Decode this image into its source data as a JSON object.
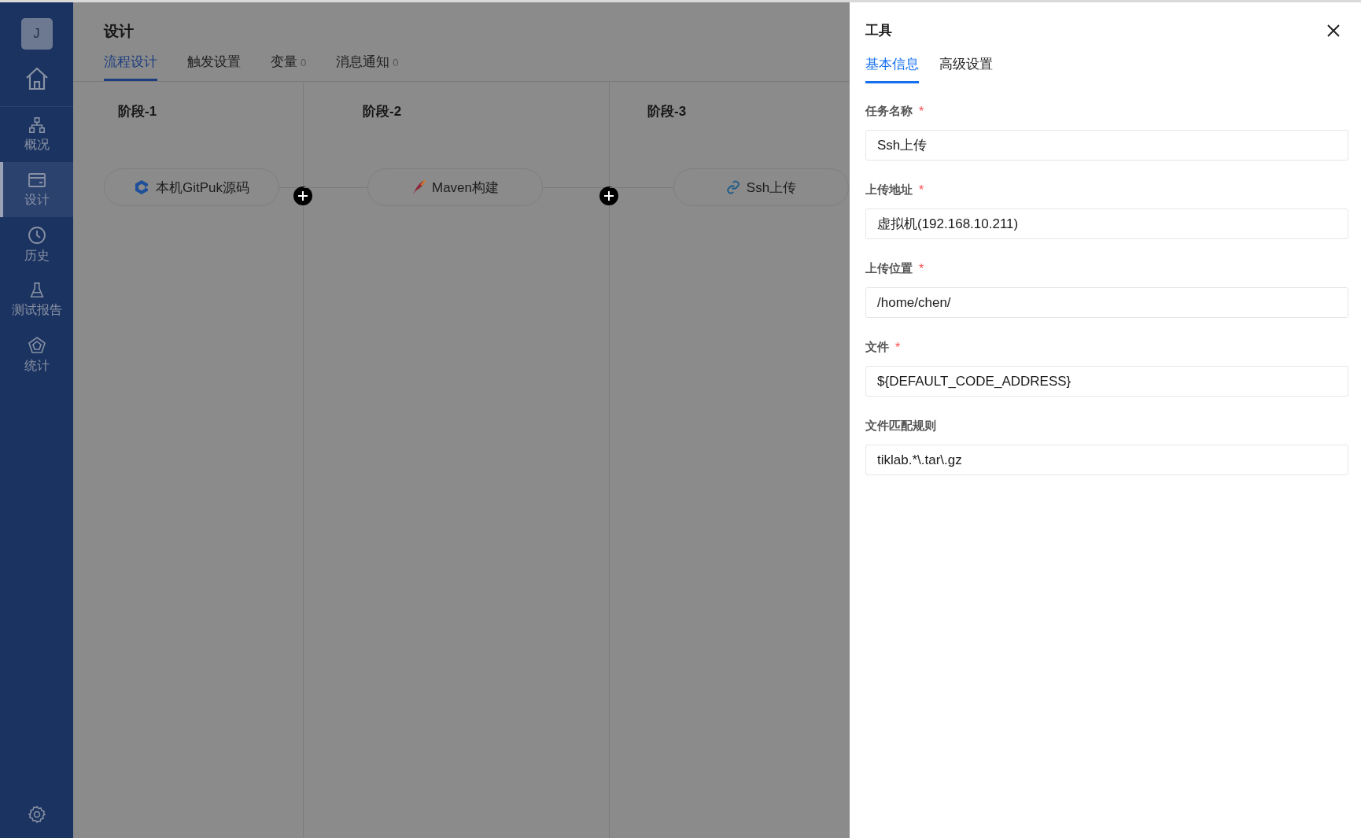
{
  "sidebar": {
    "avatar": "J",
    "items": [
      {
        "label": "概况",
        "selected": false
      },
      {
        "label": "设计",
        "selected": true
      },
      {
        "label": "历史",
        "selected": false
      },
      {
        "label": "测试报告",
        "selected": false
      },
      {
        "label": "统计",
        "selected": false
      }
    ]
  },
  "header": {
    "title": "设计",
    "tabs": [
      {
        "label": "流程设计",
        "selected": true
      },
      {
        "label": "触发设置",
        "selected": false
      },
      {
        "label": "变量",
        "count": "0",
        "selected": false
      },
      {
        "label": "消息通知",
        "count": "0",
        "selected": false
      }
    ]
  },
  "stages": [
    {
      "title": "阶段-1",
      "task": "本机GitPuk源码"
    },
    {
      "title": "阶段-2",
      "task": "Maven构建"
    },
    {
      "title": "阶段-3",
      "task": "Ssh上传"
    }
  ],
  "drawer": {
    "title": "工具",
    "tabs": [
      {
        "label": "基本信息",
        "selected": true
      },
      {
        "label": "高级设置",
        "selected": false
      }
    ],
    "fields": [
      {
        "label": "任务名称",
        "required_mark": "*",
        "value": "Ssh上传"
      },
      {
        "label": "上传地址",
        "required_mark": "*",
        "value": "虚拟机(192.168.10.211)"
      },
      {
        "label": "上传位置",
        "required_mark": "*",
        "value": "/home/chen/"
      },
      {
        "label": "文件",
        "required_mark": "*",
        "value": "${DEFAULT_CODE_ADDRESS}"
      },
      {
        "label": "文件匹配规则",
        "value": "tiklab.*\\.tar\\.gz"
      }
    ]
  }
}
